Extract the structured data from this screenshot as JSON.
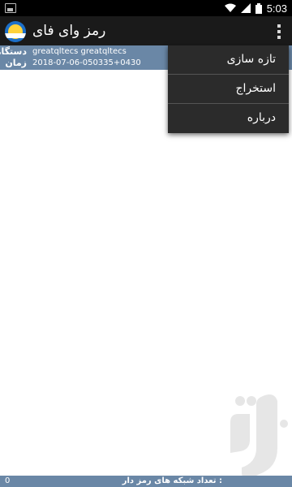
{
  "status_bar": {
    "time": "5:03",
    "icons": [
      "image-icon",
      "wifi-icon",
      "signal-icon",
      "battery-icon"
    ]
  },
  "app_bar": {
    "title": "رمز وای فای",
    "app_icon": "wifi-logo-icon",
    "overflow_icon": "more-vert-icon"
  },
  "info": {
    "device_label": "دستگاه",
    "device_value": "greatqltecs greatqltecs",
    "time_label": "زمان",
    "time_value": "2018-07-06-050335+0430"
  },
  "menu": {
    "items": [
      {
        "label": "تازه سازی"
      },
      {
        "label": "استخراج"
      },
      {
        "label": "درباره"
      }
    ]
  },
  "bottom_bar": {
    "label": "تعداد شبکه های رمز دار :",
    "count": "0"
  },
  "colors": {
    "accent": "#6a87a6",
    "action_bar": "#1a1a1a",
    "menu_bg": "#2b2b2b"
  }
}
